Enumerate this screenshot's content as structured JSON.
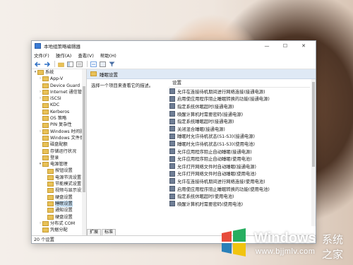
{
  "window": {
    "title": "本地组策略编辑器",
    "minimize": "—",
    "maximize": "☐",
    "close": "✕"
  },
  "menubar": [
    "文件(F)",
    "操作(A)",
    "查看(V)",
    "帮助(H)"
  ],
  "toolbar_icons": [
    "back-arrow-icon",
    "forward-arrow-icon",
    "up-folder-icon",
    "show-hide-tree-icon",
    "export-icon",
    "help-icon",
    "properties-icon",
    "filter-icon"
  ],
  "tree": [
    {
      "label": "系统",
      "level": 0,
      "caret": "▾"
    },
    {
      "label": "App-V",
      "level": 1,
      "caret": "›"
    },
    {
      "label": "Device Guard",
      "level": 1,
      "caret": ""
    },
    {
      "label": "Internet 通信管",
      "level": 1,
      "caret": "›"
    },
    {
      "label": "iSCSI",
      "level": 1,
      "caret": "›"
    },
    {
      "label": "KDC",
      "level": 1,
      "caret": ""
    },
    {
      "label": "Kerberos",
      "level": 1,
      "caret": ""
    },
    {
      "label": "OS 策略",
      "level": 1,
      "caret": ""
    },
    {
      "label": "PIN 复杂性",
      "level": 1,
      "caret": ""
    },
    {
      "label": "Windows 时间服",
      "level": 1,
      "caret": "›"
    },
    {
      "label": "Windows 文件保",
      "level": 1,
      "caret": ""
    },
    {
      "label": "磁盘配额",
      "level": 1,
      "caret": ""
    },
    {
      "label": "存储运行状况",
      "level": 1,
      "caret": ""
    },
    {
      "label": "登录",
      "level": 1,
      "caret": ""
    },
    {
      "label": "电源管理",
      "level": 1,
      "caret": "▾"
    },
    {
      "label": "按钮设置",
      "level": 2,
      "caret": ""
    },
    {
      "label": "电源节流设置",
      "level": 2,
      "caret": ""
    },
    {
      "label": "节能模式设置",
      "level": 2,
      "caret": ""
    },
    {
      "label": "视频与显示设置",
      "level": 2,
      "caret": ""
    },
    {
      "label": "硬盘设置",
      "level": 2,
      "caret": ""
    },
    {
      "label": "睡眠设置",
      "level": 2,
      "caret": "",
      "selected": true
    },
    {
      "label": "通知设置",
      "level": 2,
      "caret": ""
    },
    {
      "label": "硬盘设置",
      "level": 2,
      "caret": ""
    },
    {
      "label": "分布式 COM",
      "level": 1,
      "caret": "›"
    },
    {
      "label": "凭据分配",
      "level": 1,
      "caret": ""
    }
  ],
  "right_header": "睡眠设置",
  "description": "选择一个项目来查看它的描述。",
  "list_header": "设置",
  "settings": [
    "允许在连接待机期间进行网络连接(接通电源)",
    "启用使应用程序阻止睡眠转换的功能(接通电源)",
    "指定系统休眠超时(接通电源)",
    "唤醒计算机时需要密码(接通电源)",
    "指定系统睡眠超时(接通电源)",
    "关闭混合睡眠(接通电源)",
    "睡眠时允许待机状态(S1-S3)(接通电源)",
    "睡眠时允许待机状态(S1-S3)(使用电池)",
    "允许应用程序阻止自动睡眠(接通电源)",
    "允许应用程序阻止自动睡眠(使用电池)",
    "允许打开网络文件时自动睡眠(接通电源)",
    "允许打开网络文件时自动睡眠(使用电池)",
    "允许在连接待机期间进行网络连接(使用电池)",
    "启用使应用程序阻止睡眠转换的功能(使用电池)",
    "指定系统休眠超时(使用电池)",
    "唤醒计算机时需要密码(使用电池)"
  ],
  "tabs": [
    "扩展",
    "标准"
  ],
  "status": "20 个设置",
  "watermark": {
    "title": "Windows",
    "cn": "系统之家",
    "url": "www.bjjmlv.com"
  },
  "colors": {
    "window_bg": "#ffffff",
    "header_bg": "#dfe9f5",
    "selection": "#cce4f7",
    "folder": "#e8c158"
  }
}
